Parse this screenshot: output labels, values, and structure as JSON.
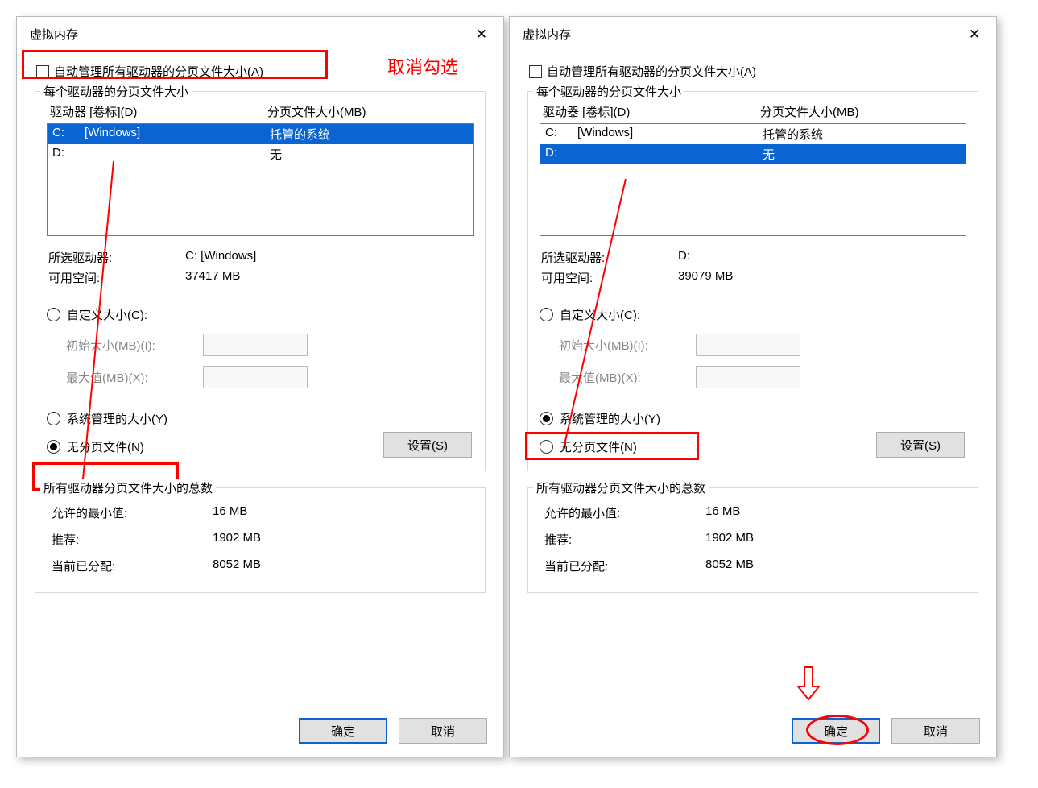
{
  "left": {
    "title": "虚拟内存",
    "auto_manage": "自动管理所有驱动器的分页文件大小(A)",
    "fieldset1_legend": "每个驱动器的分页文件大小",
    "drive_col1": "驱动器 [卷标](D)",
    "drive_col2": "分页文件大小(MB)",
    "drives": [
      {
        "letter": "C:",
        "label": "[Windows]",
        "size": "托管的系统",
        "selected": true
      },
      {
        "letter": "D:",
        "label": "",
        "size": "无",
        "selected": false
      }
    ],
    "selected_drive_lbl": "所选驱动器:",
    "selected_drive_val": "C:  [Windows]",
    "free_space_lbl": "可用空间:",
    "free_space_val": "37417 MB",
    "radio_custom": "自定义大小(C):",
    "initial_lbl": "初始大小(MB)(I):",
    "max_lbl": "最大值(MB)(X):",
    "radio_system": "系统管理的大小(Y)",
    "radio_none": "无分页文件(N)",
    "radio_selected": "none",
    "set_btn": "设置(S)",
    "fieldset2_legend": "所有驱动器分页文件大小的总数",
    "min_lbl": "允许的最小值:",
    "min_val": "16 MB",
    "rec_lbl": "推荐:",
    "rec_val": "1902 MB",
    "cur_lbl": "当前已分配:",
    "cur_val": "8052 MB",
    "ok_btn": "确定",
    "cancel_btn": "取消",
    "annotation_uncheck": "取消勾选"
  },
  "right": {
    "title": "虚拟内存",
    "auto_manage": "自动管理所有驱动器的分页文件大小(A)",
    "fieldset1_legend": "每个驱动器的分页文件大小",
    "drive_col1": "驱动器 [卷标](D)",
    "drive_col2": "分页文件大小(MB)",
    "drives": [
      {
        "letter": "C:",
        "label": "[Windows]",
        "size": "托管的系统",
        "selected": false
      },
      {
        "letter": "D:",
        "label": "",
        "size": "无",
        "selected": true
      }
    ],
    "selected_drive_lbl": "所选驱动器:",
    "selected_drive_val": "D:",
    "free_space_lbl": "可用空间:",
    "free_space_val": "39079 MB",
    "radio_custom": "自定义大小(C):",
    "initial_lbl": "初始大小(MB)(I):",
    "max_lbl": "最大值(MB)(X):",
    "radio_system": "系统管理的大小(Y)",
    "radio_none": "无分页文件(N)",
    "radio_selected": "system",
    "set_btn": "设置(S)",
    "fieldset2_legend": "所有驱动器分页文件大小的总数",
    "min_lbl": "允许的最小值:",
    "min_val": "16 MB",
    "rec_lbl": "推荐:",
    "rec_val": "1902 MB",
    "cur_lbl": "当前已分配:",
    "cur_val": "8052 MB",
    "ok_btn": "确定",
    "cancel_btn": "取消"
  }
}
